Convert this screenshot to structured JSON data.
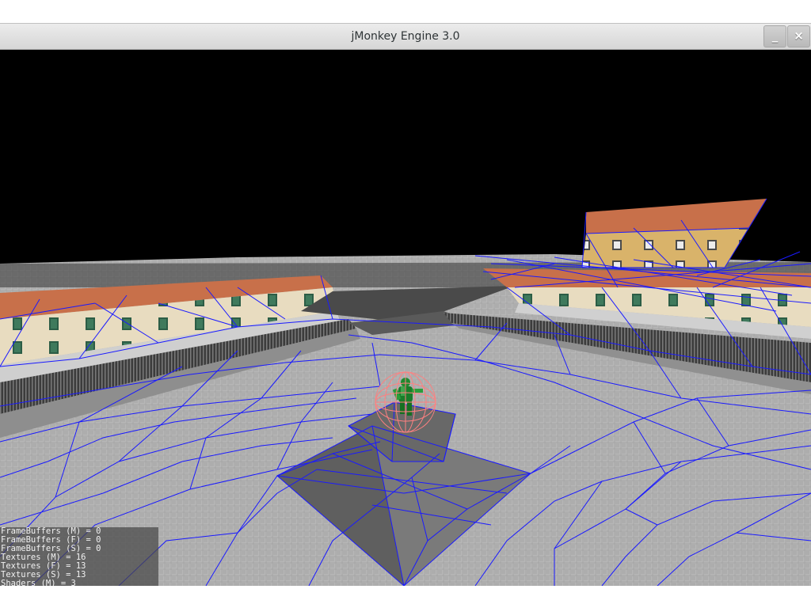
{
  "window": {
    "title": "jMonkey Engine 3.0",
    "minimize_glyph": "_",
    "close_glyph": "×"
  },
  "scene": {
    "description_icons": [
      "wireframe-navmesh",
      "character-model",
      "bounding-sphere",
      "building",
      "pyramid"
    ],
    "colors": {
      "sky": "#000000",
      "wireframe": "#1a1aff",
      "bounding_sphere": "#ff8080",
      "character": "#1a8a2a",
      "roof": "#c8704a",
      "floor": "#a9a9a9"
    }
  },
  "stats": {
    "lines": [
      "FrameBuffers (M) = 0",
      "FrameBuffers (F) = 0",
      "FrameBuffers (S) = 0",
      "Textures (M) = 16",
      "Textures (F) = 13",
      "Textures (S) = 13",
      "Shaders (M) = 3"
    ]
  }
}
